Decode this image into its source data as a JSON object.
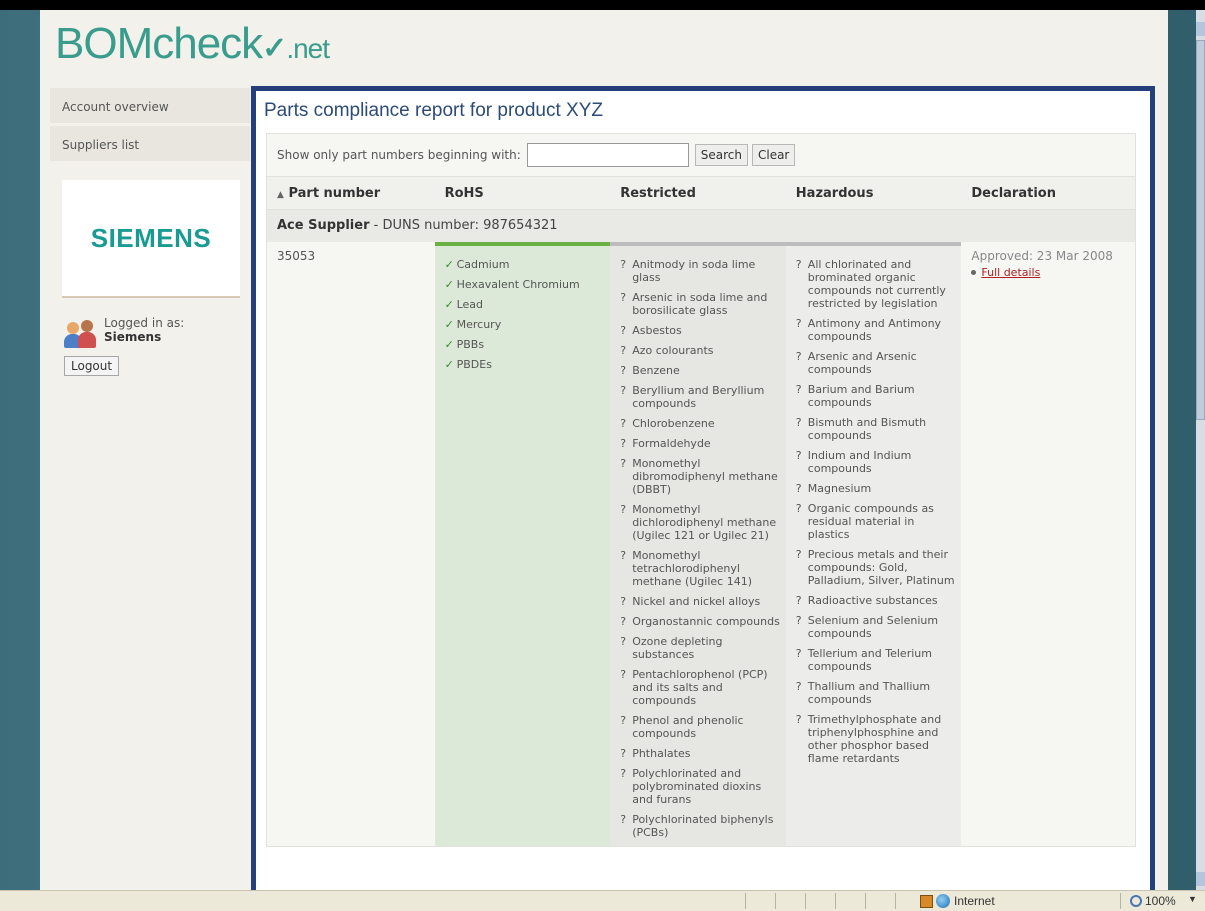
{
  "brand": {
    "logo_text": "BOMcheck",
    "logo_tick": "✓",
    "logo_suffix": ".net"
  },
  "sidebar": {
    "items": [
      {
        "label": "Account overview"
      },
      {
        "label": "Suppliers list"
      }
    ],
    "company_logo_text": "SIEMENS",
    "logged_in_label": "Logged in as:",
    "logged_in_user": "Siemens",
    "logout_label": "Logout"
  },
  "report": {
    "title": "Parts compliance report for product XYZ",
    "filter_label": "Show only part numbers beginning with:",
    "filter_value": "",
    "search_label": "Search",
    "clear_label": "Clear",
    "columns": [
      "Part number",
      "RoHS",
      "Restricted",
      "Hazardous",
      "Declaration"
    ],
    "sort_icon": "sort-arrows-icon",
    "supplier_name": "Ace Supplier",
    "supplier_duns": "- DUNS number: 987654321",
    "part_number": "35053",
    "rohs": [
      "Cadmium",
      "Hexavalent Chromium",
      "Lead",
      "Mercury",
      "PBBs",
      "PBDEs"
    ],
    "restricted": [
      "Anitmody in soda lime glass",
      "Arsenic in soda lime and borosilicate glass",
      "Asbestos",
      "Azo colourants",
      "Benzene",
      "Beryllium and Beryllium compounds",
      "Chlorobenzene",
      "Formaldehyde",
      "Monomethyl dibromodiphenyl methane (DBBT)",
      "Monomethyl dichlorodiphenyl methane (Ugilec 121 or Ugilec 21)",
      "Monomethyl tetrachlorodiphenyl methane (Ugilec 141)",
      "Nickel and nickel alloys",
      "Organostannic compounds",
      "Ozone depleting substances",
      "Pentachlorophenol (PCP) and its salts and compounds",
      "Phenol and phenolic compounds",
      "Phthalates",
      "Polychlorinated and polybrominated dioxins and furans",
      "Polychlorinated biphenyls (PCBs)"
    ],
    "hazardous": [
      "All chlorinated and brominated organic compounds not currently restricted by legislation",
      "Antimony and Antimony compounds",
      "Arsenic and Arsenic compounds",
      "Barium and Barium compounds",
      "Bismuth and Bismuth compounds",
      "Indium and Indium compounds",
      "Magnesium",
      "Organic compounds as residual material in plastics",
      "Precious metals and their compounds: Gold, Palladium, Silver, Platinum",
      "Radioactive substances",
      "Selenium and Selenium compounds",
      "Tellerium and Telerium compounds",
      "Thallium and Thallium compounds",
      "Trimethylphosphate and triphenylphosphine and other phosphor based flame retardants"
    ],
    "declaration_status": "Approved: 23 Mar 2008",
    "declaration_link": "Full details",
    "check_mark": "✓",
    "question_mark": "?"
  },
  "statusbar": {
    "zone_label": "Internet",
    "zoom_label": "100%",
    "zoom_arrow": "▼"
  },
  "colors": {
    "brand_teal": "#3a9c8c",
    "content_border": "#243f7a",
    "rohs_ok_green": "#6bb043",
    "link_red": "#b02020"
  }
}
